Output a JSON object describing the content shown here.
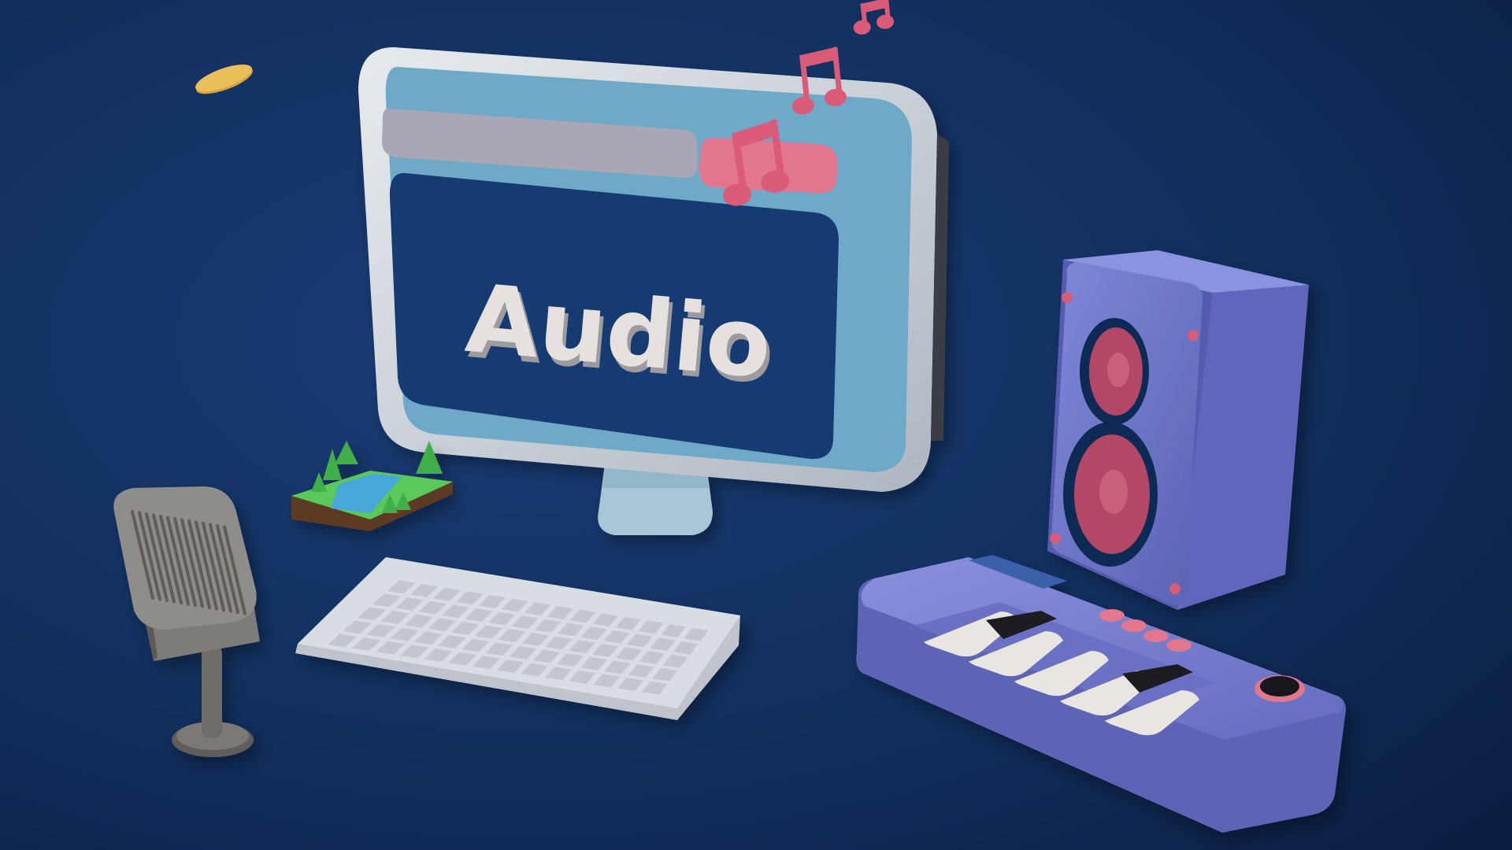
{
  "scene": {
    "screen_text": "Audio"
  },
  "colors": {
    "background": "#12305f",
    "background_dark": "#0b1f43",
    "monitor_bezel": "#cfd4db",
    "monitor_screen_frame": "#6ea9c7",
    "monitor_screen_inner": "#143a72",
    "address_bar": "#a9a6b5",
    "music_note": "#d95b78",
    "music_tab": "#e2768f",
    "text_3d": "#e6e1df",
    "keyboard": "#d8dce3",
    "speaker_body": "#6b74c6",
    "speaker_cone": "#b24666",
    "synth_body": "#7c82cf",
    "synth_key_white": "#e9e5e0",
    "synth_key_black": "#1b1b20",
    "mic_metal": "#8f8d8a",
    "coin": "#d8a33a",
    "grass": "#58c95a",
    "water": "#4aa6d9",
    "dirt": "#5b3b20"
  },
  "icons": {
    "monitor": "monitor-icon",
    "note_small_top": "music-note-icon",
    "note_small_mid": "music-note-icon",
    "note_tab": "music-note-icon",
    "speaker": "speaker-icon",
    "synth": "piano-keyboard-icon",
    "mic": "microphone-icon",
    "keyboard": "computer-keyboard-icon",
    "island": "tiny-landscape-icon",
    "coin": "coin-icon"
  }
}
